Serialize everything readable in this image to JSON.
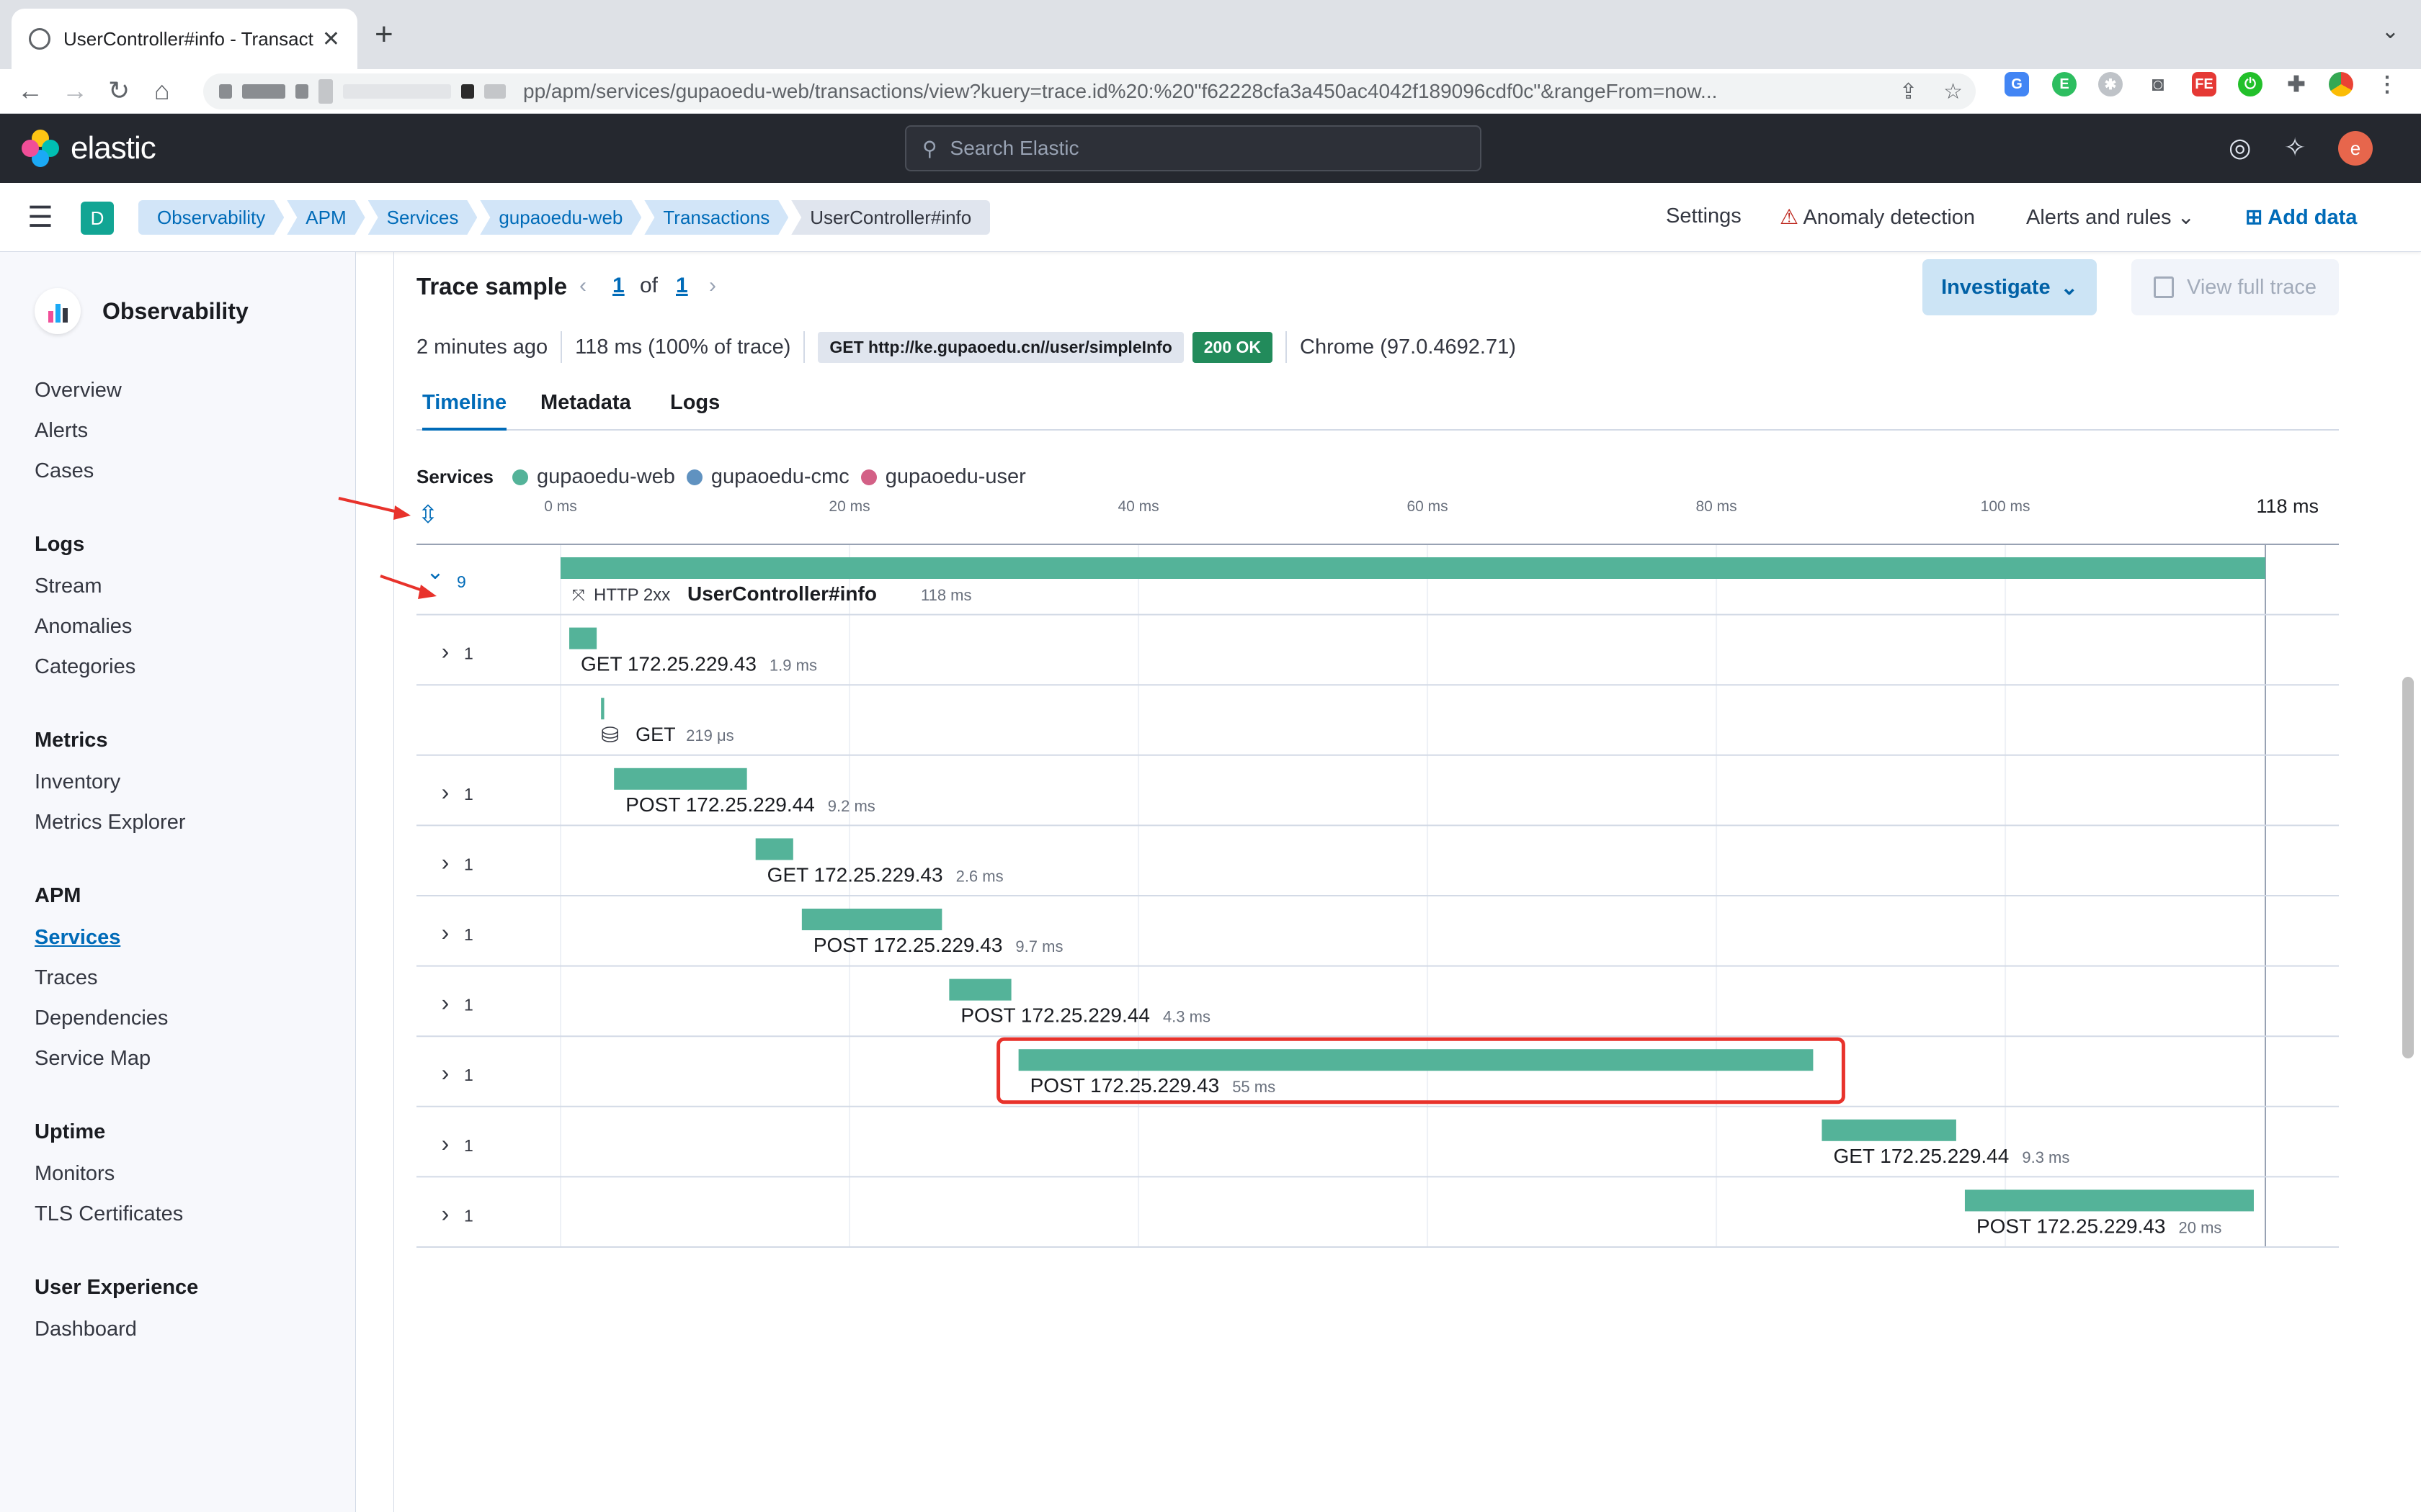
{
  "browser": {
    "tab_title": "UserController#info - Transacti",
    "url": "pp/apm/services/gupaoedu-web/transactions/view?kuery=trace.id%20:%20\"f62228cfa3a450ac4042f189096cdf0c\"&rangeFrom=now..."
  },
  "header": {
    "brand": "elastic",
    "search_placeholder": "Search Elastic",
    "avatar_letter": "e"
  },
  "breadcrumbs": {
    "space_letter": "D",
    "items": [
      "Observability",
      "APM",
      "Services",
      "gupaoedu-web",
      "Transactions",
      "UserController#info"
    ],
    "settings": "Settings",
    "anomaly": "Anomaly detection",
    "alerts": "Alerts and rules",
    "add_data": "Add data"
  },
  "sidebar": {
    "title": "Observability",
    "overview": "Overview",
    "alerts": "Alerts",
    "cases": "Cases",
    "logs": {
      "label": "Logs",
      "items": [
        "Stream",
        "Anomalies",
        "Categories"
      ]
    },
    "metrics": {
      "label": "Metrics",
      "items": [
        "Inventory",
        "Metrics Explorer"
      ]
    },
    "apm": {
      "label": "APM",
      "items": [
        "Services",
        "Traces",
        "Dependencies",
        "Service Map"
      ],
      "active": "Services"
    },
    "uptime": {
      "label": "Uptime",
      "items": [
        "Monitors",
        "TLS Certificates"
      ]
    },
    "ux": {
      "label": "User Experience",
      "items": [
        "Dashboard"
      ]
    }
  },
  "trace": {
    "title": "Trace sample",
    "page": "1",
    "of": "of",
    "total": "1",
    "investigate": "Investigate",
    "view_full": "View full trace",
    "time_ago": "2 minutes ago",
    "duration": "118 ms",
    "duration_pct": "(100% of trace)",
    "request": "GET http://ke.gupaoedu.cn//user/simpleInfo",
    "status": "200 OK",
    "browser": "Chrome (97.0.4692.71)",
    "tabs": [
      "Timeline",
      "Metadata",
      "Logs"
    ],
    "active_tab": "Timeline"
  },
  "legend": {
    "label": "Services",
    "services": [
      {
        "name": "gupaoedu-web",
        "color": "#54b399"
      },
      {
        "name": "gupaoedu-cmc",
        "color": "#6092c0"
      },
      {
        "name": "gupaoedu-user",
        "color": "#d36086"
      }
    ]
  },
  "waterfall": {
    "max_ms": 118,
    "axis_ticks": [
      0,
      20,
      40,
      60,
      80,
      100
    ],
    "axis_unit": "ms",
    "axis_end_label": "118 ms",
    "bar_color": "#54b399",
    "highlight_color": "#e8322b",
    "rows": [
      {
        "count": "9",
        "expanded": true,
        "start": 0,
        "duration": 118,
        "method": "HTTP 2xx",
        "name": "UserController#info",
        "dur_label": "118 ms",
        "kind": "transaction"
      },
      {
        "count": "1",
        "start": 0.6,
        "duration": 1.9,
        "name": "GET 172.25.229.43",
        "dur_label": "1.9 ms",
        "kind": "span"
      },
      {
        "count": "",
        "start": 2.8,
        "duration": 0.219,
        "name": "GET",
        "dur_label": "219 μs",
        "kind": "db"
      },
      {
        "count": "1",
        "start": 3.7,
        "duration": 9.2,
        "name": "POST 172.25.229.44",
        "dur_label": "9.2 ms",
        "kind": "span"
      },
      {
        "count": "1",
        "start": 13.5,
        "duration": 2.6,
        "name": "GET 172.25.229.43",
        "dur_label": "2.6 ms",
        "kind": "span"
      },
      {
        "count": "1",
        "start": 16.7,
        "duration": 9.7,
        "name": "POST 172.25.229.43",
        "dur_label": "9.7 ms",
        "kind": "span"
      },
      {
        "count": "1",
        "start": 26.9,
        "duration": 4.3,
        "name": "POST 172.25.229.44",
        "dur_label": "4.3 ms",
        "kind": "span"
      },
      {
        "count": "1",
        "start": 31.7,
        "duration": 55,
        "name": "POST 172.25.229.43",
        "dur_label": "55 ms",
        "kind": "span",
        "highlight": true
      },
      {
        "count": "1",
        "start": 87.3,
        "duration": 9.3,
        "name": "GET 172.25.229.44",
        "dur_label": "9.3 ms",
        "kind": "span"
      },
      {
        "count": "1",
        "start": 97.2,
        "duration": 20,
        "name": "POST 172.25.229.43",
        "dur_label": "20 ms",
        "kind": "span"
      }
    ]
  }
}
